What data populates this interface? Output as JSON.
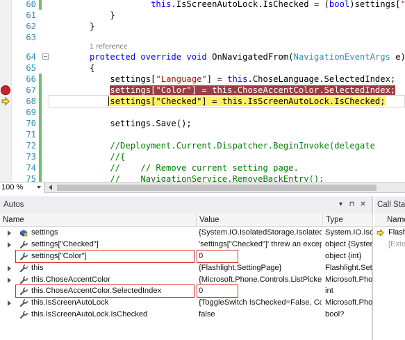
{
  "editor": {
    "lines": [
      {
        "num": "60",
        "segments": [
          {
            "t": "            "
          },
          {
            "t": "this",
            "c": "kw"
          },
          {
            "t": ".IsScreenAutoLock.IsChecked = ("
          },
          {
            "t": "bool",
            "c": "kw"
          },
          {
            "t": ")settings["
          },
          {
            "t": "\"Checked\"",
            "c": "str"
          },
          {
            "t": "];"
          }
        ]
      },
      {
        "num": "61",
        "segments": [
          {
            "t": "    }"
          }
        ]
      },
      {
        "num": "62",
        "segments": [
          {
            "t": "}"
          }
        ]
      },
      {
        "num": "63",
        "segments": []
      },
      {
        "num": "64",
        "segments": [
          {
            "t": "protected override void",
            "c": "kw"
          },
          {
            "t": " OnNavigatedFrom("
          },
          {
            "t": "NavigationEventArgs",
            "c": "ty"
          },
          {
            "t": " e)"
          }
        ]
      },
      {
        "num": "65",
        "segments": [
          {
            "t": "{"
          }
        ]
      },
      {
        "num": "66",
        "segments": [
          {
            "t": "    settings["
          },
          {
            "t": "\"Language\"",
            "c": "str"
          },
          {
            "t": "] = "
          },
          {
            "t": "this",
            "c": "kw"
          },
          {
            "t": ".ChoseLanguage.SelectedIndex;"
          }
        ]
      },
      {
        "num": "67",
        "segments": [
          {
            "t": "    "
          },
          {
            "t": "settings[\"Color\"] = this.ChoseAccentColor.SelectedIndex;",
            "hl": "red"
          }
        ]
      },
      {
        "num": "68",
        "segments": [
          {
            "t": "    "
          },
          {
            "t": "settings[\"Checked\"] = this.IsScreenAutoLock.IsChecked;",
            "hl": "yellow"
          }
        ]
      },
      {
        "num": "69",
        "segments": []
      },
      {
        "num": "70",
        "segments": [
          {
            "t": "    settings.Save();"
          }
        ]
      },
      {
        "num": "71",
        "segments": []
      },
      {
        "num": "72",
        "segments": [
          {
            "t": "    //Deployment.Current.Dispatcher.BeginInvoke(delegate",
            "c": "cm"
          }
        ]
      },
      {
        "num": "73",
        "segments": [
          {
            "t": "    //{",
            "c": "cm"
          }
        ]
      },
      {
        "num": "74",
        "segments": [
          {
            "t": "    //    // Remove current setting page.",
            "c": "cm"
          }
        ]
      },
      {
        "num": "75",
        "segments": [
          {
            "t": "    //    NavigationService.RemoveBackEntry();",
            "c": "cm"
          }
        ]
      }
    ],
    "reference_label": "1 reference",
    "zoom": "100 %"
  },
  "autos": {
    "title": "Autos",
    "columns": {
      "name": "Name",
      "value": "Value",
      "type": "Type"
    },
    "rows": [
      {
        "name": "settings",
        "value": "{System.IO.IsolatedStorage.IsolatedStorageSettings}",
        "type": "System.IO.IsolatedStorage.IsolatedStorageSettings",
        "expandable": true,
        "icon": "field"
      },
      {
        "name": "settings[\"Checked\"]",
        "value": "'settings[\"Checked\"]' threw an exception of type 'System.Collections.Generic.KeyNotFoundException'",
        "type": "object {System.Collections.Generic.KeyNotFoundException}",
        "expandable": true,
        "icon": "wrench"
      },
      {
        "name": "settings[\"Color\"]",
        "value": "0",
        "type": "object {int}",
        "expandable": false,
        "icon": "wrench",
        "boxed": true
      },
      {
        "name": "this",
        "value": "{Flashlight.SettingPage}",
        "type": "Flashlight.SettingPage",
        "expandable": true,
        "icon": "wrench"
      },
      {
        "name": "this.ChoseAccentColor",
        "value": "{Microsoft.Phone.Controls.ListPicker}",
        "type": "Microsoft.Phone.Controls.ListPicker",
        "expandable": true,
        "icon": "wrench"
      },
      {
        "name": "this.ChoseAccentColor.SelectedIndex",
        "value": "0",
        "type": "int",
        "expandable": false,
        "icon": "wrench",
        "boxed": true
      },
      {
        "name": "this.IsScreenAutoLock",
        "value": "{ToggleSwitch IsChecked=False, Content=}",
        "type": "Microsoft.Phone.Controls.ToggleSwitch",
        "expandable": true,
        "icon": "wrench"
      },
      {
        "name": "this.IsScreenAutoLock.IsChecked",
        "value": "false",
        "type": "bool?",
        "expandable": false,
        "icon": "wrench"
      }
    ]
  },
  "callstack": {
    "title": "Call Stack",
    "column": "Name",
    "rows": [
      {
        "text": "Flashlight.dll!Flashlight.SettingPage.OnNavigatedFrom",
        "current": true
      },
      {
        "text": "[External Code]",
        "current": false
      }
    ]
  },
  "colors": {
    "breakpoint": "#c8232a",
    "current_line": "#ffee62",
    "highlight_red": "#9e3d41",
    "selection_box": "#d62a2a"
  }
}
